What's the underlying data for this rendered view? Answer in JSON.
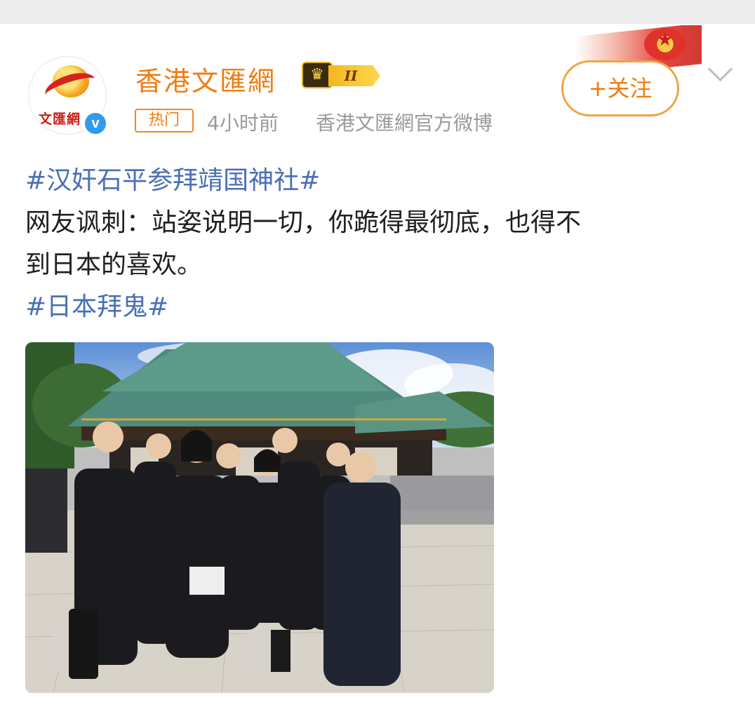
{
  "account": {
    "name": "香港文匯網",
    "avatar_text": "文匯網",
    "verified_mark": "v",
    "member_level": "II"
  },
  "meta": {
    "hot_tag": "热门",
    "time": "4小时前",
    "source": "香港文匯網官方微博"
  },
  "actions": {
    "follow_label": "+关注",
    "more_icon": "chevron-down-icon"
  },
  "post": {
    "hashtag_1": "#汉奸石平参拜靖国神社#",
    "body_line_1": "网友讽刺：站姿说明一切，你跪得最彻底，也得不",
    "body_line_2": "到日本的喜欢。",
    "hashtag_2": "#日本拜鬼#"
  },
  "colors": {
    "accent_orange": "#f07c10",
    "hashtag_blue": "#4a6fb5",
    "meta_gray": "#9a9a9a",
    "verified_blue": "#2f9bf0"
  }
}
